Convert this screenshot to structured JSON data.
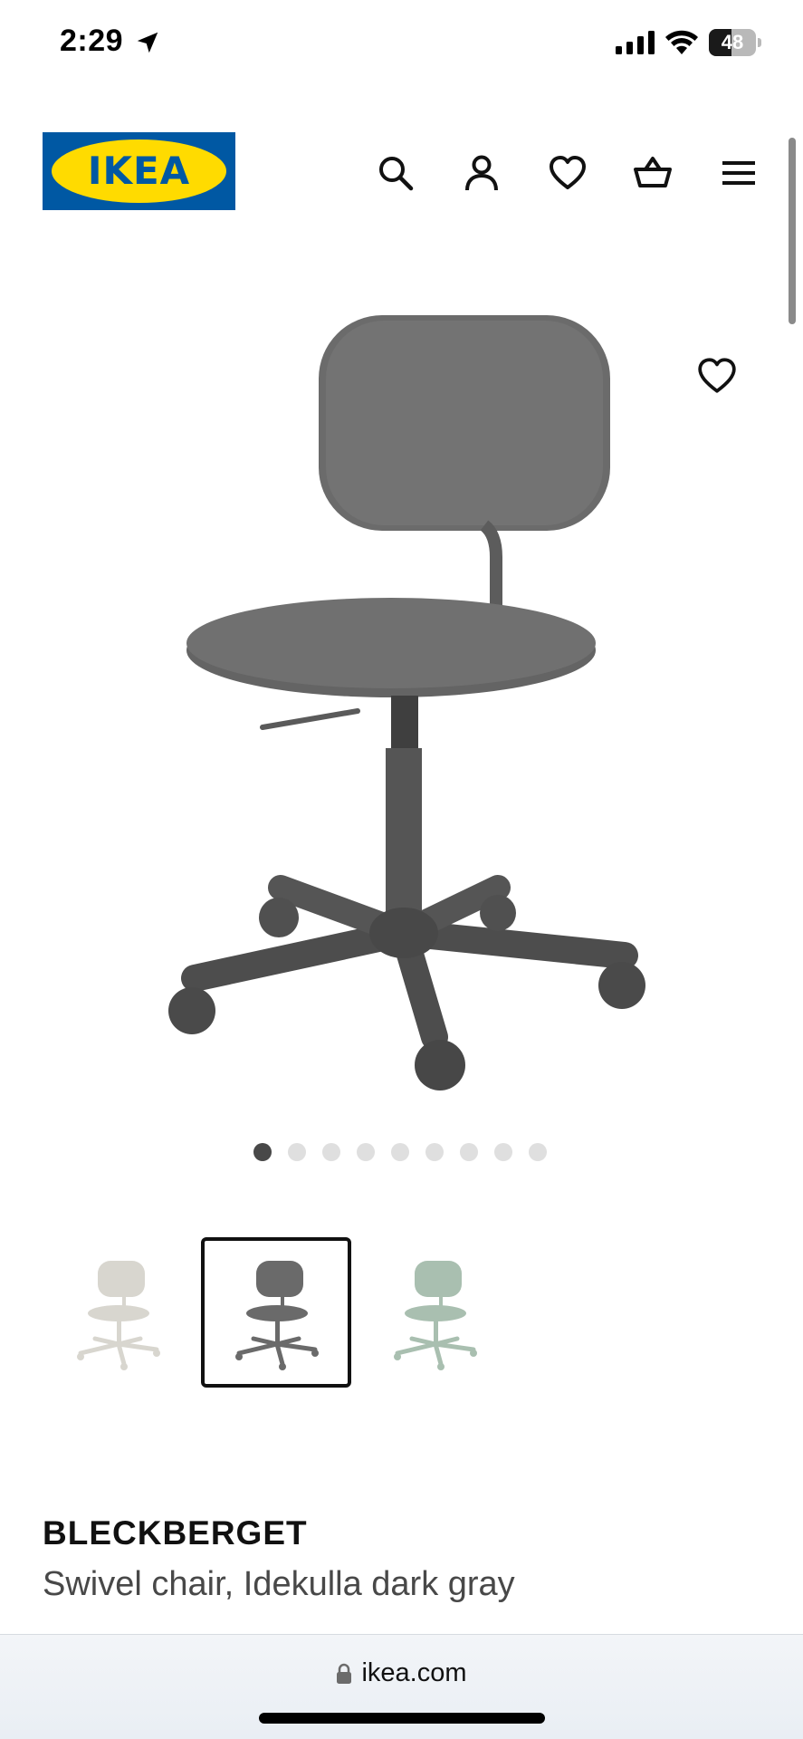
{
  "status_bar": {
    "time": "2:29",
    "battery_level": "48",
    "battery_fraction": 0.48
  },
  "header": {
    "logo_text": "IKEA",
    "colors": {
      "brand_blue": "#0058a3",
      "brand_yellow": "#ffdb00"
    },
    "nav": [
      {
        "name": "search",
        "icon": "search-icon"
      },
      {
        "name": "account",
        "icon": "user-icon"
      },
      {
        "name": "favourites",
        "icon": "heart-icon"
      },
      {
        "name": "cart",
        "icon": "basket-icon"
      },
      {
        "name": "menu",
        "icon": "hamburger-icon"
      }
    ]
  },
  "gallery": {
    "image": "swivel-chair-dark-gray",
    "favourite_icon": "heart-icon",
    "total_images": 9,
    "active_index": 0
  },
  "variants": [
    {
      "color": "beige",
      "hex": "#d8d6cf",
      "selected": false
    },
    {
      "color": "dark gray",
      "hex": "#6a6a6a",
      "selected": true
    },
    {
      "color": "green",
      "hex": "#a9bfb0",
      "selected": false
    }
  ],
  "product": {
    "name": "BLECKBERGET",
    "description": "Swivel chair, Idekulla dark gray"
  },
  "browser": {
    "url": "ikea.com",
    "lock_icon": "lock-icon"
  }
}
